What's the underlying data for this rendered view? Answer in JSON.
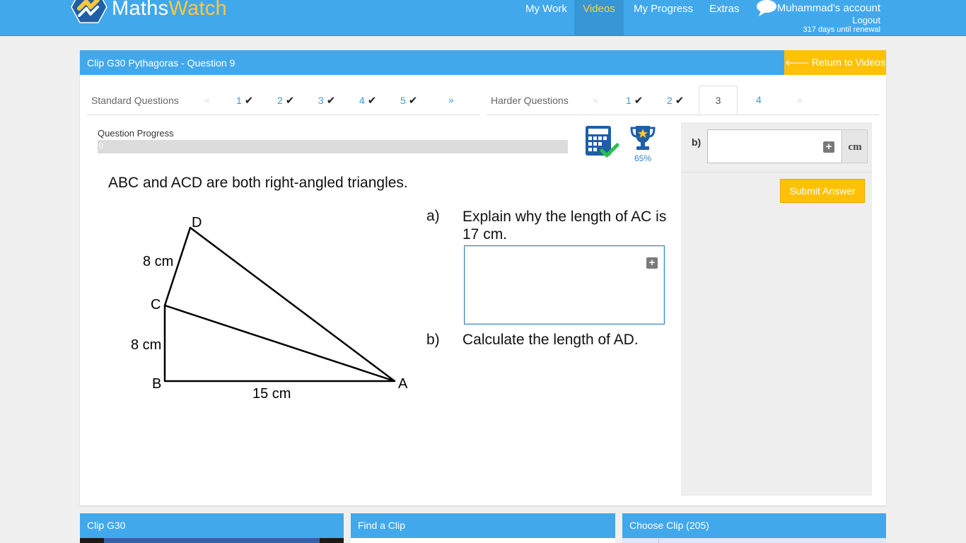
{
  "brand": {
    "logo_part1": "Maths",
    "logo_part2": "Watch"
  },
  "nav": {
    "items": [
      {
        "label": "My Work"
      },
      {
        "label": "Videos"
      },
      {
        "label": "My Progress"
      },
      {
        "label": "Extras"
      }
    ],
    "active": "Videos"
  },
  "account": {
    "name": "Muhammad's account",
    "logout": "Logout",
    "renewal": "317 days until renewal"
  },
  "panel": {
    "title": "Clip G30 Pythagoras - Question 9",
    "return_label": "Return to Videos"
  },
  "tabs": {
    "standard_label": "Standard Questions",
    "standard": [
      {
        "label": "«",
        "state": "disabled"
      },
      {
        "label": "1",
        "done": true
      },
      {
        "label": "2",
        "done": true
      },
      {
        "label": "3",
        "done": true
      },
      {
        "label": "4",
        "done": true
      },
      {
        "label": "5",
        "done": true
      },
      {
        "label": "»"
      }
    ],
    "harder_label": "Harder Questions",
    "harder": [
      {
        "label": "«",
        "state": "disabled"
      },
      {
        "label": "1",
        "done": true
      },
      {
        "label": "2",
        "done": true
      },
      {
        "label": "3",
        "state": "current"
      },
      {
        "label": "4"
      },
      {
        "label": "»",
        "state": "disabled"
      }
    ],
    "tick": "✔"
  },
  "progress": {
    "label": "Question Progress",
    "value": 0,
    "value_text": "0",
    "trophy_pct": "65%"
  },
  "question": {
    "intro": "ABC and ACD are both right-angled triangles.",
    "part_a_label": "a)",
    "part_a_text": "Explain why the length of AC is 17 cm.",
    "part_b_label": "b)",
    "part_b_text": "Calculate the length of AD.",
    "diagram": {
      "points": {
        "A": "A",
        "B": "B",
        "C": "C",
        "D": "D"
      },
      "lengths": {
        "CD": "8 cm",
        "BC": "8 cm",
        "AB": "15 cm"
      }
    }
  },
  "answer_b": {
    "label": "b)",
    "unit": "cm",
    "value": ""
  },
  "submit_label": "Submit Answer",
  "bottom": {
    "clip_title": "Clip G30",
    "find_title": "Find a Clip",
    "choose_title": "Choose Clip (205)"
  },
  "colors": {
    "brand_blue": "#42a8ec",
    "accent_yellow": "#ffc107",
    "link_blue": "#3a9ad9"
  }
}
